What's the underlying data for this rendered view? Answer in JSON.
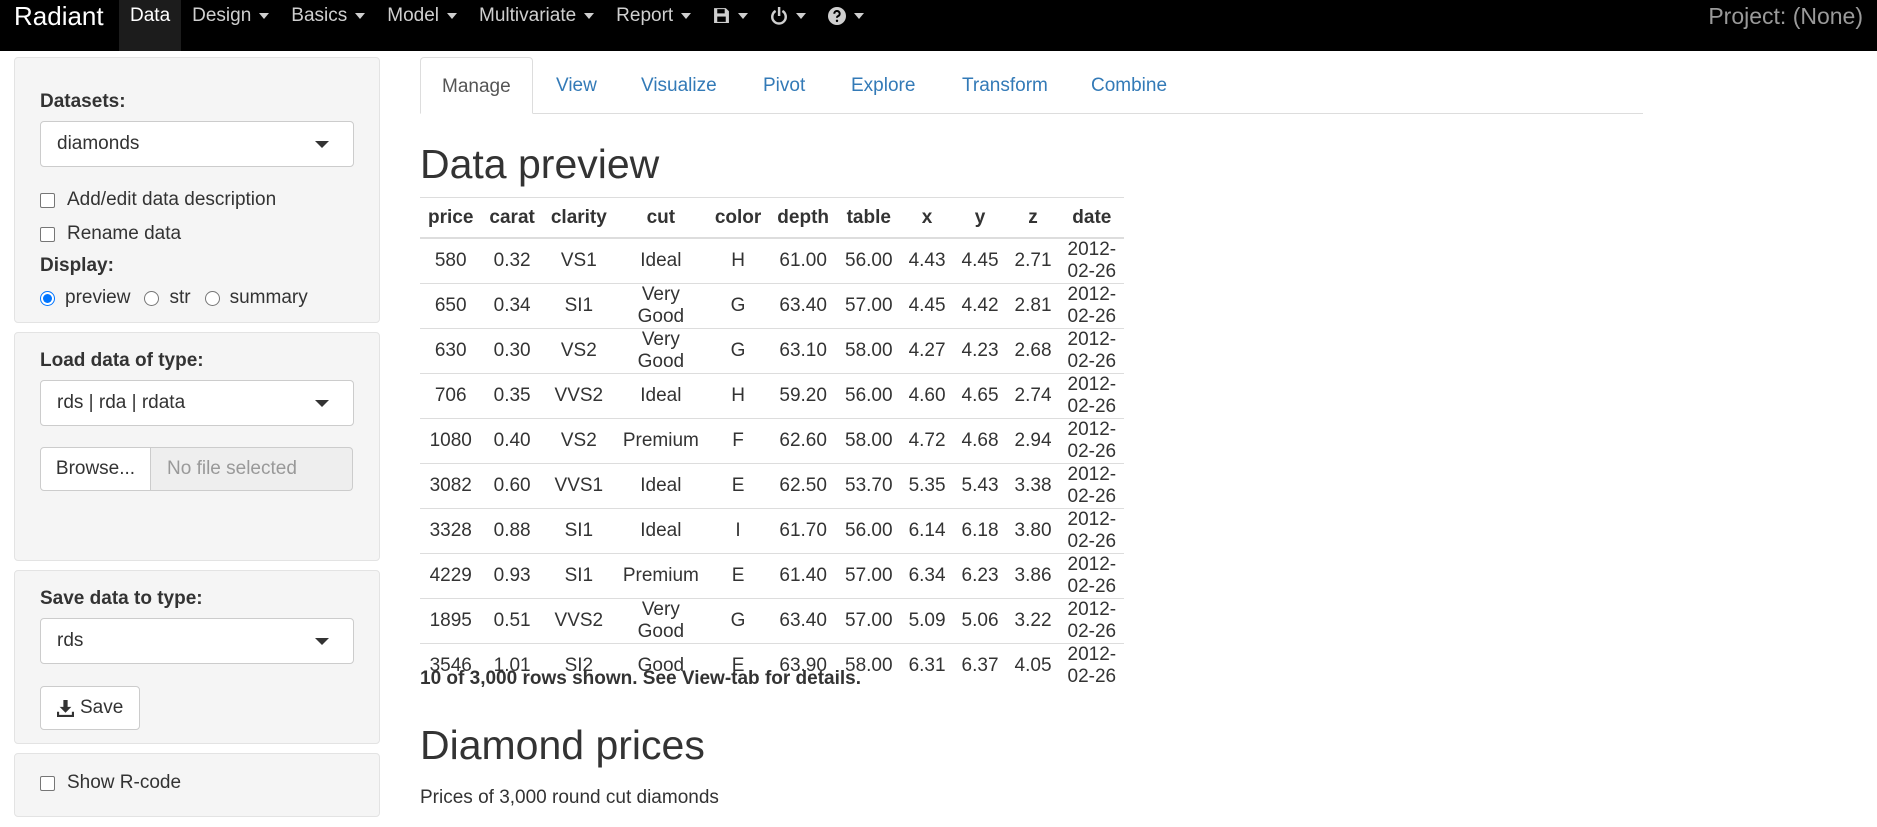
{
  "navbar": {
    "brand": "Radiant",
    "items": [
      {
        "label": "Data"
      },
      {
        "label": "Design"
      },
      {
        "label": "Basics"
      },
      {
        "label": "Model"
      },
      {
        "label": "Multivariate"
      },
      {
        "label": "Report"
      }
    ],
    "icons": [
      "save-icon",
      "power-icon",
      "help-icon"
    ],
    "project": "Project: (None)"
  },
  "sidebar": {
    "datasets_label": "Datasets:",
    "dataset_selected": "diamonds",
    "add_edit_desc": "Add/edit data description",
    "rename_data": "Rename data",
    "display_label": "Display:",
    "display_options": [
      "preview",
      "str",
      "summary"
    ],
    "display_selected": "preview",
    "load_label": "Load data of type:",
    "load_selected": "rds | rda | rdata",
    "browse_label": "Browse...",
    "file_placeholder": "No file selected",
    "save_type_label": "Save data to type:",
    "save_type_selected": "rds",
    "save_button": "Save",
    "show_rcode": "Show R-code"
  },
  "tabs": [
    "Manage",
    "View",
    "Visualize",
    "Pivot",
    "Explore",
    "Transform",
    "Combine"
  ],
  "active_tab": "Manage",
  "main": {
    "preview_title": "Data preview",
    "table": {
      "columns": [
        "price",
        "carat",
        "clarity",
        "cut",
        "color",
        "depth",
        "table",
        "x",
        "y",
        "z",
        "date"
      ],
      "rows": [
        [
          "580",
          "0.32",
          "VS1",
          "Ideal",
          "H",
          "61.00",
          "56.00",
          "4.43",
          "4.45",
          "2.71",
          "2012-02-26"
        ],
        [
          "650",
          "0.34",
          "SI1",
          "Very Good",
          "G",
          "63.40",
          "57.00",
          "4.45",
          "4.42",
          "2.81",
          "2012-02-26"
        ],
        [
          "630",
          "0.30",
          "VS2",
          "Very Good",
          "G",
          "63.10",
          "58.00",
          "4.27",
          "4.23",
          "2.68",
          "2012-02-26"
        ],
        [
          "706",
          "0.35",
          "VVS2",
          "Ideal",
          "H",
          "59.20",
          "56.00",
          "4.60",
          "4.65",
          "2.74",
          "2012-02-26"
        ],
        [
          "1080",
          "0.40",
          "VS2",
          "Premium",
          "F",
          "62.60",
          "58.00",
          "4.72",
          "4.68",
          "2.94",
          "2012-02-26"
        ],
        [
          "3082",
          "0.60",
          "VVS1",
          "Ideal",
          "E",
          "62.50",
          "53.70",
          "5.35",
          "5.43",
          "3.38",
          "2012-02-26"
        ],
        [
          "3328",
          "0.88",
          "SI1",
          "Ideal",
          "I",
          "61.70",
          "56.00",
          "6.14",
          "6.18",
          "3.80",
          "2012-02-26"
        ],
        [
          "4229",
          "0.93",
          "SI1",
          "Premium",
          "E",
          "61.40",
          "57.00",
          "6.34",
          "6.23",
          "3.86",
          "2012-02-26"
        ],
        [
          "1895",
          "0.51",
          "VVS2",
          "Very Good",
          "G",
          "63.40",
          "57.00",
          "5.09",
          "5.06",
          "3.22",
          "2012-02-26"
        ],
        [
          "3546",
          "1.01",
          "SI2",
          "Good",
          "E",
          "63.90",
          "58.00",
          "6.31",
          "6.37",
          "4.05",
          "2012-02-26"
        ]
      ]
    },
    "rows_note": "10 of 3,000 rows shown. See View-tab for details.",
    "desc_title": "Diamond prices",
    "desc_text": "Prices of 3,000 round cut diamonds"
  }
}
